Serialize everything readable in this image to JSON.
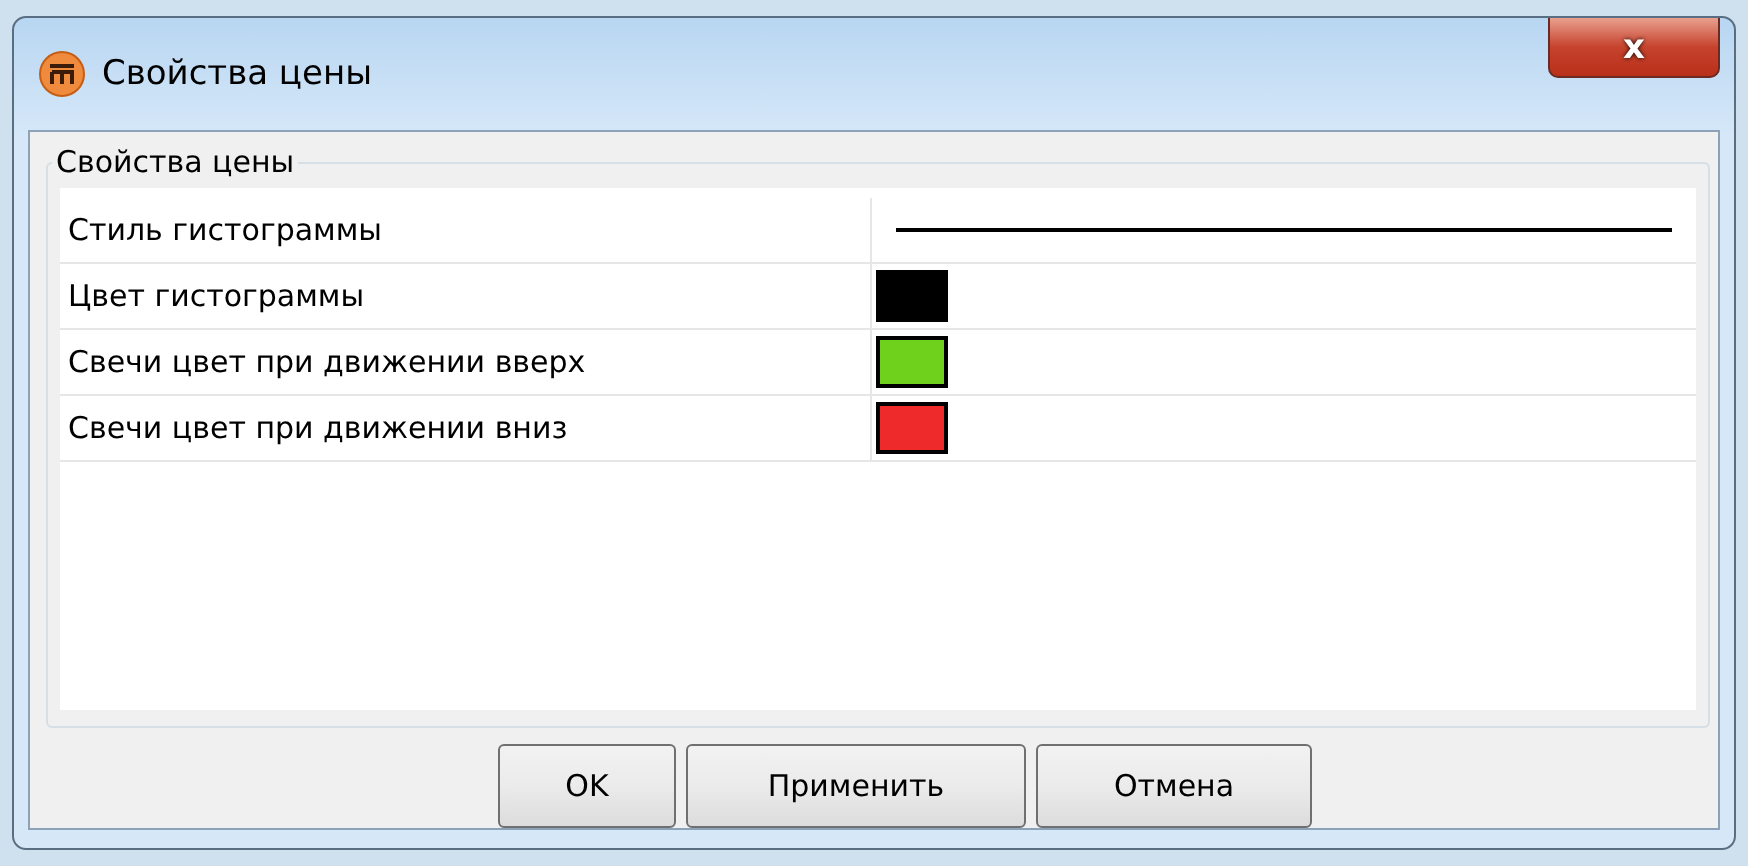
{
  "window": {
    "title": "Свойства цены",
    "close": "x"
  },
  "group": {
    "title": "Свойства цены"
  },
  "rows": [
    {
      "label": "Стиль гистограммы",
      "kind": "line",
      "color": "#000000"
    },
    {
      "label": "Цвет гистограммы",
      "kind": "color",
      "color": "#000000"
    },
    {
      "label": "Свечи цвет при движении вверх",
      "kind": "color",
      "color": "#6fd11c"
    },
    {
      "label": "Свечи цвет при движении вниз",
      "kind": "color",
      "color": "#ee2a2a"
    }
  ],
  "buttons": [
    "OK",
    "Применить",
    "Отмена"
  ]
}
